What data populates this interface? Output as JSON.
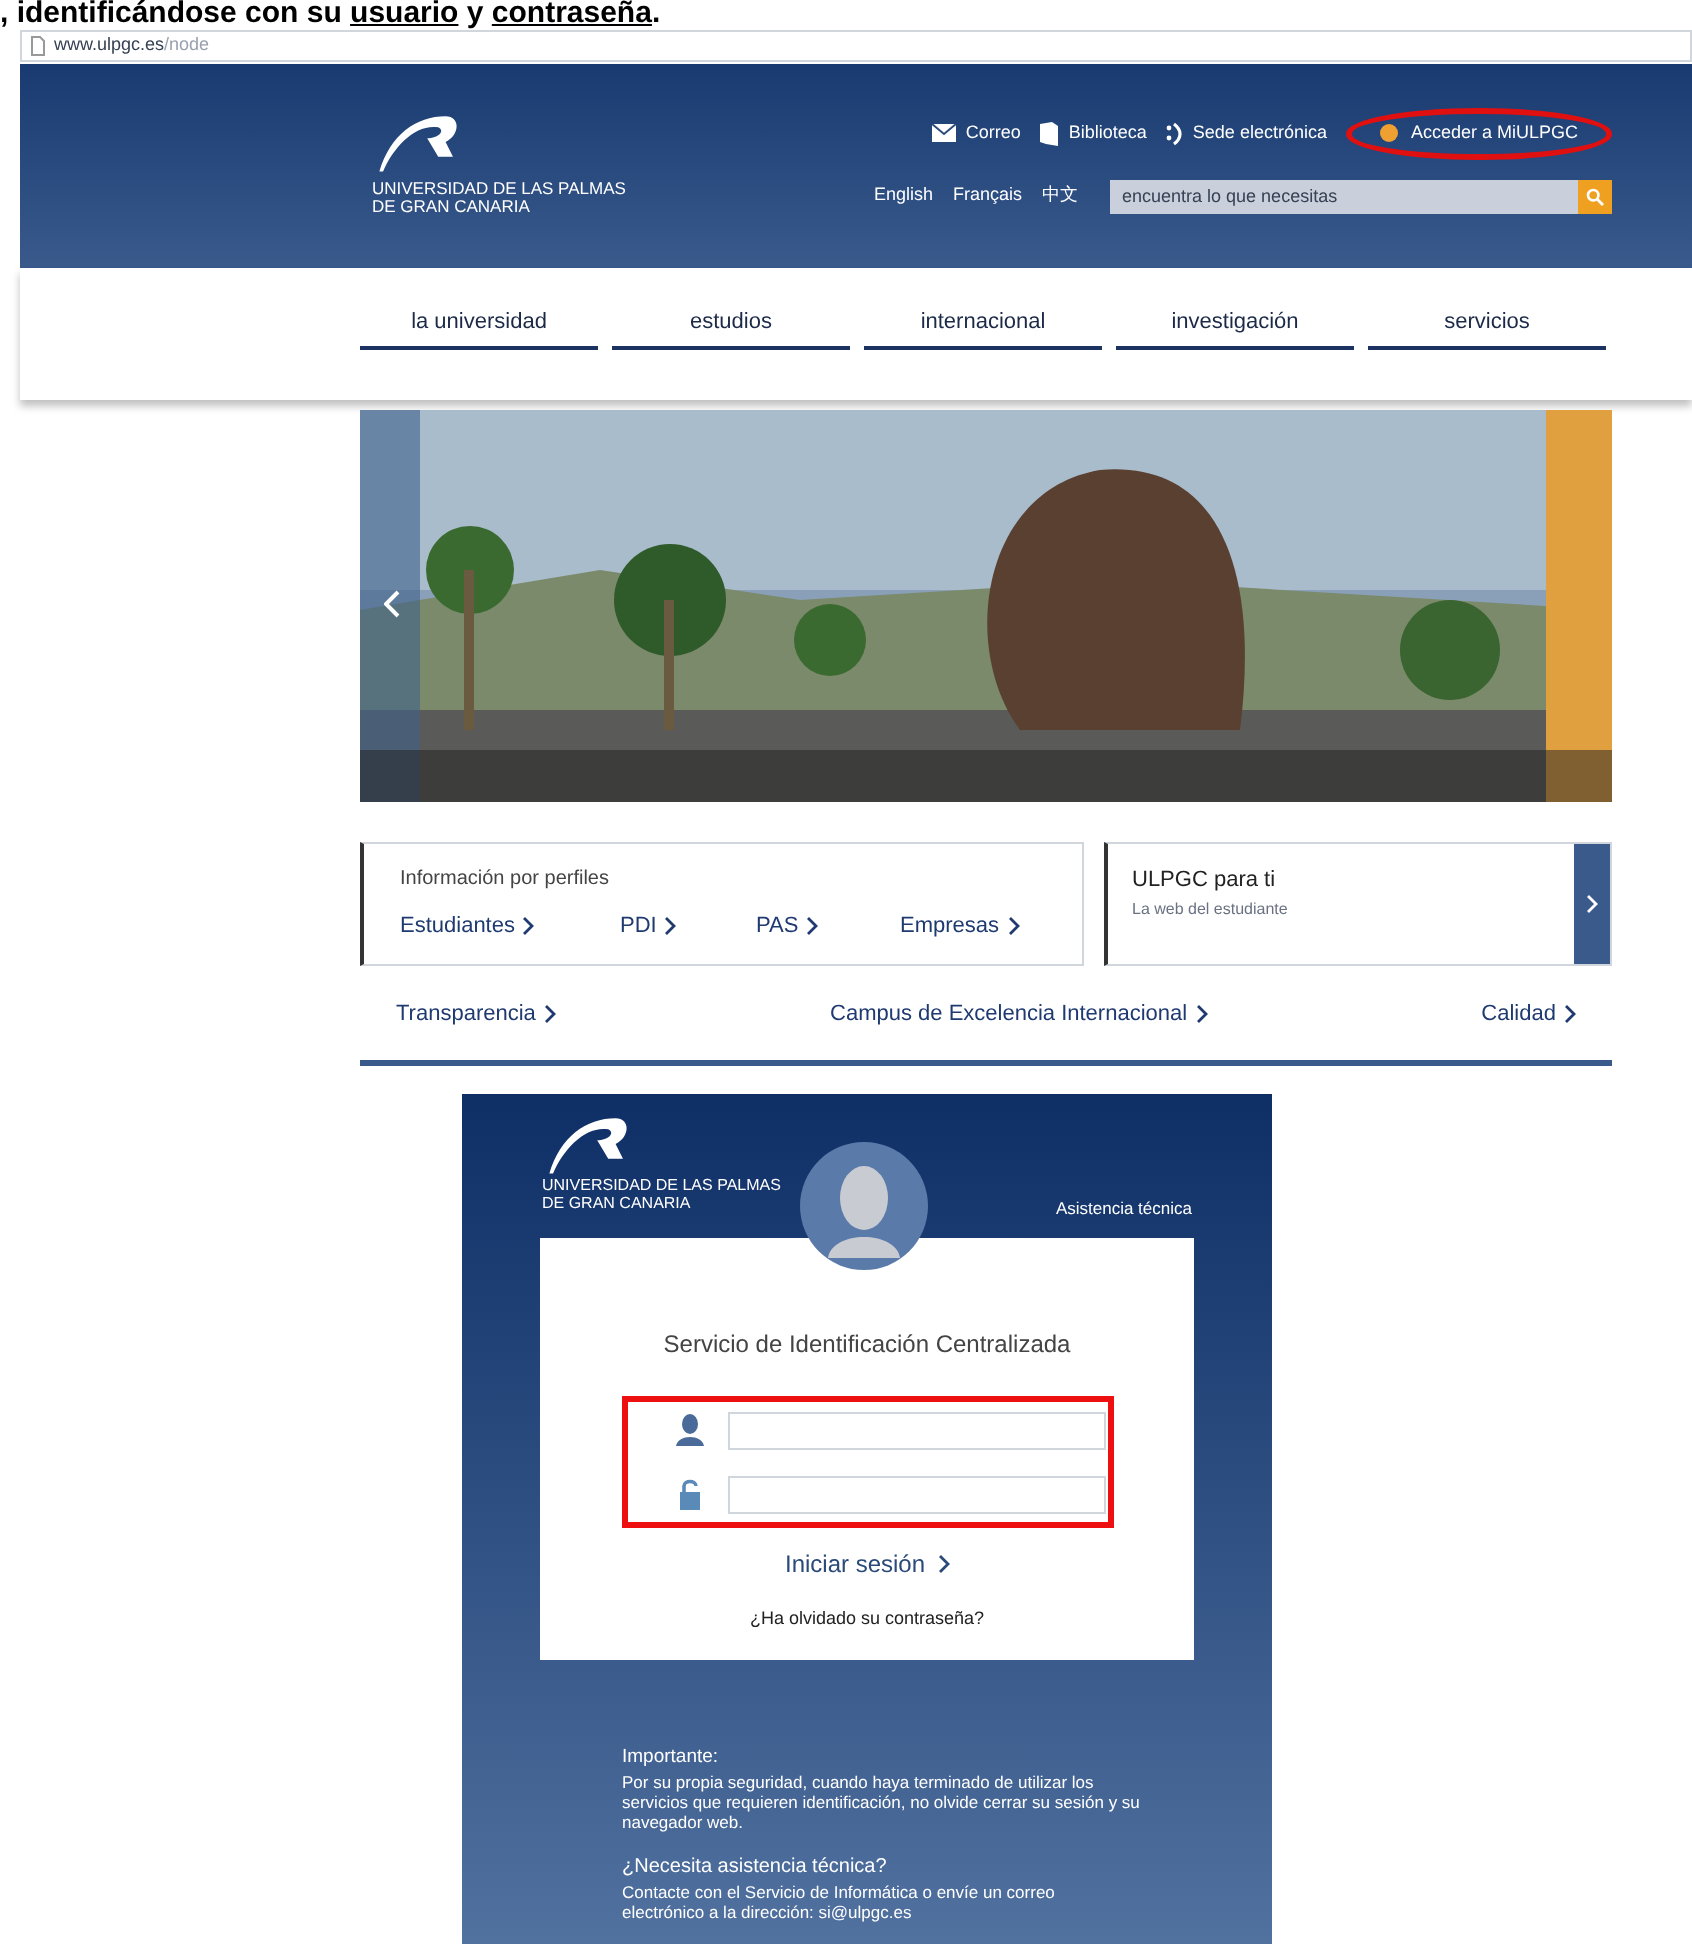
{
  "caption": [
    {
      "text": ", identificándose con su ",
      "underlined": false
    },
    {
      "text": "usuario",
      "underlined": true
    },
    {
      "text": " y ",
      "underlined": false
    },
    {
      "text": "contraseña",
      "underlined": true
    },
    {
      "text": ".",
      "underlined": false
    }
  ],
  "browser": {
    "url_host": "www.ulpgc.es",
    "url_path": "/node"
  },
  "header": {
    "logo_line_1": "UNIVERSIDAD DE LAS PALMAS",
    "logo_line_2": "DE GRAN CANARIA",
    "links": [
      {
        "kind": "mail",
        "label": "Correo",
        "circled": false
      },
      {
        "kind": "book",
        "label": "Biblioteca",
        "circled": false
      },
      {
        "kind": "smile",
        "label": "Sede electrónica",
        "circled": false
      },
      {
        "kind": "dot",
        "label": "Acceder a MiULPGC",
        "circled": true
      }
    ],
    "languages": [
      "English",
      "Français",
      "中文"
    ],
    "search": {
      "placeholder": "encuentra lo que necesitas"
    }
  },
  "nav": [
    "la universidad",
    "estudios",
    "internacional",
    "investigación",
    "servicios"
  ],
  "hero": {
    "kind": "picture"
  },
  "profiles": {
    "title": "Información por perfiles",
    "links": [
      "Estudiantes",
      "PDI",
      "PAS",
      "Empresas"
    ]
  },
  "promo": {
    "title": "ULPGC para ti",
    "subtitle": "La web del estudiante"
  },
  "bottom_links": [
    "Transparencia",
    "Campus de Excelencia Internacional",
    "Calidad"
  ],
  "login": {
    "logo_line_1": "UNIVERSIDAD DE LAS PALMAS",
    "logo_line_2": "DE GRAN CANARIA",
    "help_link": "Asistencia técnica",
    "title": "Servicio de Identificación Centralizada",
    "fields": [
      {
        "kind": "username"
      },
      {
        "kind": "password"
      }
    ],
    "fields_boxed": true,
    "submit": "Iniciar sesión",
    "forgot": "¿Ha olvidado su contraseña?",
    "notice_title": "Importante:",
    "notice_text": "Por su propia seguridad, cuando haya terminado de utilizar los servicios que requieren identificación, no olvide cerrar su sesión y su navegador web.",
    "help_title": "¿Necesita asistencia técnica?",
    "help_text": "Contacte con el Servicio de Informática o envíe un correo electrónico a la dirección: si@ulpgc.es"
  }
}
